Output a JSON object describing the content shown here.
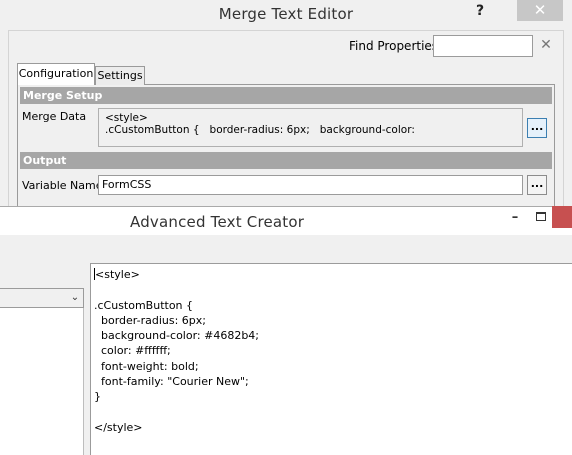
{
  "merge_text_editor": {
    "title": "Merge Text Editor",
    "help_label": "?",
    "close_label": "✕",
    "find": {
      "label": "Find Properties",
      "value": "",
      "clear_label": "✕"
    },
    "tabs": [
      {
        "label": "Configuration",
        "active": true
      },
      {
        "label": "Settings",
        "active": false
      }
    ],
    "sections": {
      "merge_setup": {
        "title": "Merge Setup",
        "merge_data_label": "Merge Data",
        "merge_data_lines": [
          "<style>",
          ".cCustomButton {   border-radius: 6px;   background-color:"
        ],
        "browse_label": "..."
      },
      "output": {
        "title": "Output",
        "variable_name_label": "Variable Name",
        "variable_name_value": "FormCSS",
        "browse_label": "..."
      }
    }
  },
  "advanced_text_creator": {
    "title": "Advanced Text Creator",
    "minimize_label": "–",
    "combo_arrow": "chevron-down-icon",
    "editor_lines": [
      "<style>",
      "",
      ".cCustomButton {",
      "  border-radius: 6px;",
      "  background-color: #4682b4;",
      "  color: #ffffff;",
      "  font-weight: bold;",
      "  font-family: \"Courier New\";",
      "}",
      "",
      "</style>"
    ]
  },
  "colors": {
    "section_header": "#a6a6a6",
    "close_button_red": "#c75050",
    "chrome": "#f0f0f0"
  }
}
